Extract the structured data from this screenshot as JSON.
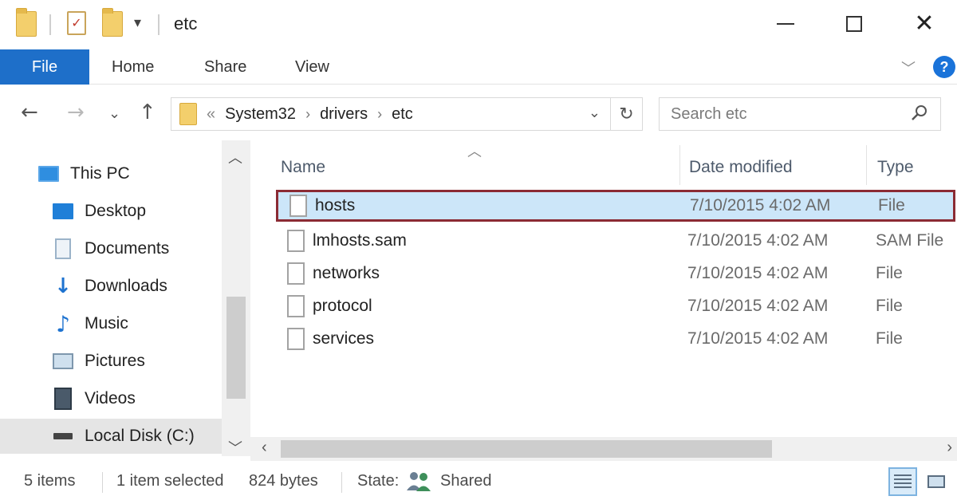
{
  "window": {
    "title": "etc",
    "minimize_icon": "minimize-icon",
    "maximize_icon": "maximize-icon",
    "close_icon": "close-icon"
  },
  "ribbon": {
    "tabs": [
      {
        "label": "File"
      },
      {
        "label": "Home"
      },
      {
        "label": "Share"
      },
      {
        "label": "View"
      }
    ],
    "help_label": "?"
  },
  "address": {
    "overflow": "«",
    "path": [
      "System32",
      "drivers",
      "etc"
    ],
    "search_placeholder": "Search etc"
  },
  "nav_pane": {
    "items": [
      {
        "label": "This PC",
        "icon": "computer-icon"
      },
      {
        "label": "Desktop",
        "icon": "desktop-icon"
      },
      {
        "label": "Documents",
        "icon": "documents-icon"
      },
      {
        "label": "Downloads",
        "icon": "downloads-icon"
      },
      {
        "label": "Music",
        "icon": "music-icon"
      },
      {
        "label": "Pictures",
        "icon": "pictures-icon"
      },
      {
        "label": "Videos",
        "icon": "videos-icon"
      },
      {
        "label": "Local Disk (C:)",
        "icon": "drive-icon",
        "selected": true
      }
    ]
  },
  "file_list": {
    "columns": [
      {
        "label": "Name"
      },
      {
        "label": "Date modified"
      },
      {
        "label": "Type"
      }
    ],
    "rows": [
      {
        "name": "hosts",
        "date": "7/10/2015 4:02 AM",
        "type": "File",
        "selected": true
      },
      {
        "name": "lmhosts.sam",
        "date": "7/10/2015 4:02 AM",
        "type": "SAM File"
      },
      {
        "name": "networks",
        "date": "7/10/2015 4:02 AM",
        "type": "File"
      },
      {
        "name": "protocol",
        "date": "7/10/2015 4:02 AM",
        "type": "File"
      },
      {
        "name": "services",
        "date": "7/10/2015 4:02 AM",
        "type": "File"
      }
    ]
  },
  "status": {
    "item_count": "5 items",
    "selection": "1 item selected",
    "size": "824 bytes",
    "state_label": "State:",
    "state_value": "Shared"
  },
  "colors": {
    "accent": "#1e6fc9",
    "selection_bg": "#cce6f9",
    "highlight_border": "#8b2b34"
  }
}
